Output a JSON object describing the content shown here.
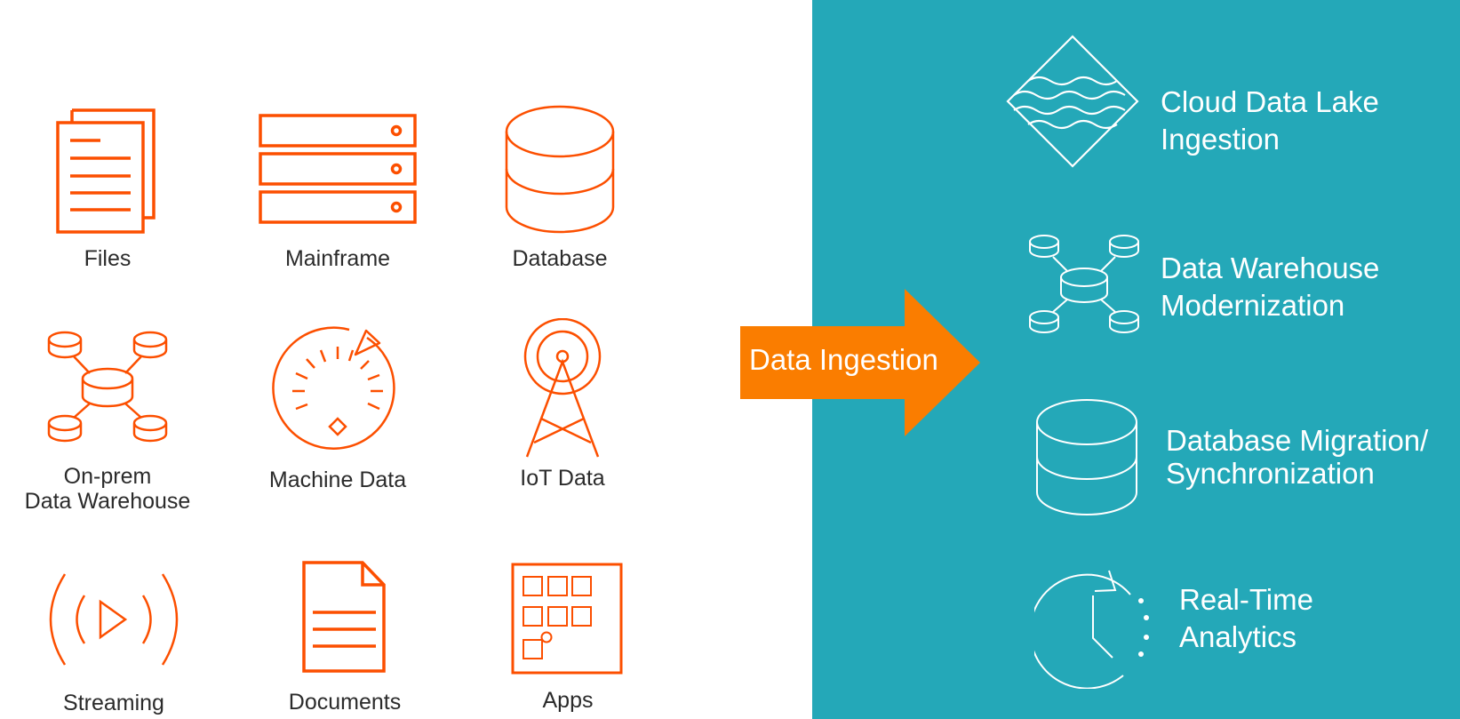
{
  "colors": {
    "source_icon": "#fc4f00",
    "panel_bg": "#24a8b8",
    "arrow": "#fa7d00",
    "label_dark": "#2b2b2b",
    "label_light": "#ffffff"
  },
  "sources": [
    {
      "label": "Files",
      "icon": "files-icon"
    },
    {
      "label": "Mainframe",
      "icon": "mainframe-icon"
    },
    {
      "label": "Database",
      "icon": "database-icon"
    },
    {
      "label_line1": "On-prem",
      "label_line2": "Data Warehouse",
      "icon": "data-warehouse-icon"
    },
    {
      "label": "Machine Data",
      "icon": "gauge-icon"
    },
    {
      "label": "IoT Data",
      "icon": "antenna-tower-icon"
    },
    {
      "label": "Streaming",
      "icon": "streaming-icon"
    },
    {
      "label": "Documents",
      "icon": "document-icon"
    },
    {
      "label": "Apps",
      "icon": "apps-icon"
    }
  ],
  "arrow": {
    "label": "Data Ingestion"
  },
  "targets": [
    {
      "line1": "Cloud Data Lake",
      "line2": "Ingestion",
      "icon": "data-lake-icon"
    },
    {
      "line1": "Data Warehouse",
      "line2": "Modernization",
      "icon": "data-warehouse-icon"
    },
    {
      "line1": "Database Migration/",
      "line2": "Synchronization",
      "icon": "database-icon"
    },
    {
      "line1": "Real-Time",
      "line2": "Analytics",
      "icon": "clock-icon"
    }
  ]
}
